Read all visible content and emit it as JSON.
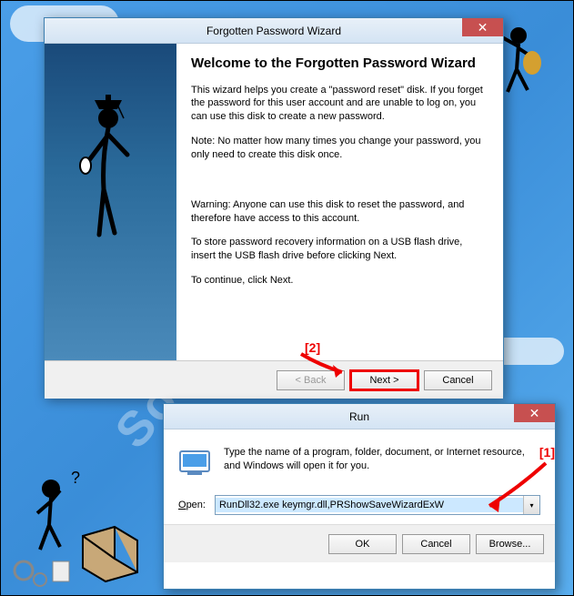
{
  "watermark": "SoftwareOK.com",
  "wizard": {
    "title": "Forgotten Password Wizard",
    "heading": "Welcome to the Forgotten Password Wizard",
    "para1": "This wizard helps you create a \"password reset\" disk. If you forget the password for this user account and are unable to log on, you can use this disk to create a new password.",
    "para2": "Note: No matter how many times you change your password, you only need to create this disk once.",
    "para3": "Warning: Anyone can use this disk to reset the password, and therefore have access to this account.",
    "para4": "To store password recovery information on a USB flash drive, insert the USB flash drive before clicking Next.",
    "para5": "To continue, click Next.",
    "buttons": {
      "back": "< Back",
      "next": "Next >",
      "cancel": "Cancel"
    }
  },
  "run": {
    "title": "Run",
    "description": "Type the name of a program, folder, document, or Internet resource, and Windows will open it for you.",
    "label": "Open:",
    "value": "RunDll32.exe keymgr.dll,PRShowSaveWizardExW",
    "buttons": {
      "ok": "OK",
      "cancel": "Cancel",
      "browse": "Browse..."
    }
  },
  "annotations": {
    "one": "[1]",
    "two": "[2]"
  }
}
